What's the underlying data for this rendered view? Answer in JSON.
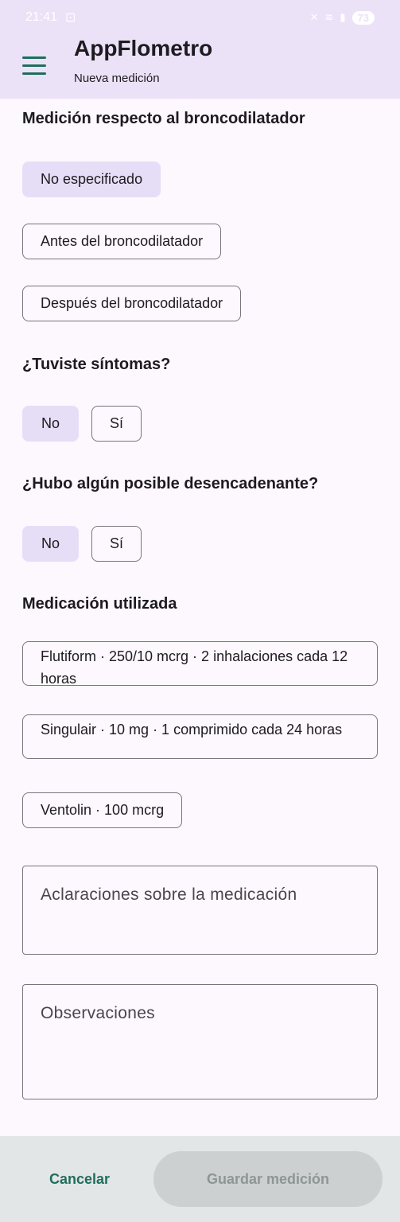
{
  "status_bar": {
    "time": "21:41",
    "battery": "73"
  },
  "app_bar": {
    "title": "AppFlometro",
    "subtitle": "Nueva medición"
  },
  "bronchodilator": {
    "title": "Medición respecto al broncodilatador",
    "options": [
      "No especificado",
      "Antes del broncodilatador",
      "Después del broncodilatador"
    ],
    "selected": "No especificado"
  },
  "symptoms": {
    "title": "¿Tuviste síntomas?",
    "no": "No",
    "yes": "Sí",
    "selected": "No"
  },
  "trigger": {
    "title": "¿Hubo algún posible desencadenante?",
    "no": "No",
    "yes": "Sí",
    "selected": "No"
  },
  "medication": {
    "title": "Medicación utilizada",
    "items": [
      "Flutiform · 250/10 mcrg · 2 inhalaciones cada 12 horas",
      "Singulair · 10 mg · 1 comprimido cada 24 horas",
      "Ventolin · 100 mcrg"
    ]
  },
  "fields": {
    "medication_notes_placeholder": "Aclaraciones sobre la medicación",
    "observations_placeholder": "Observaciones"
  },
  "actions": {
    "cancel": "Cancelar",
    "save": "Guardar medición"
  },
  "colors": {
    "accent": "#1f6e5c",
    "selected_chip": "#e6def6",
    "app_bar": "#ebe2f7"
  }
}
